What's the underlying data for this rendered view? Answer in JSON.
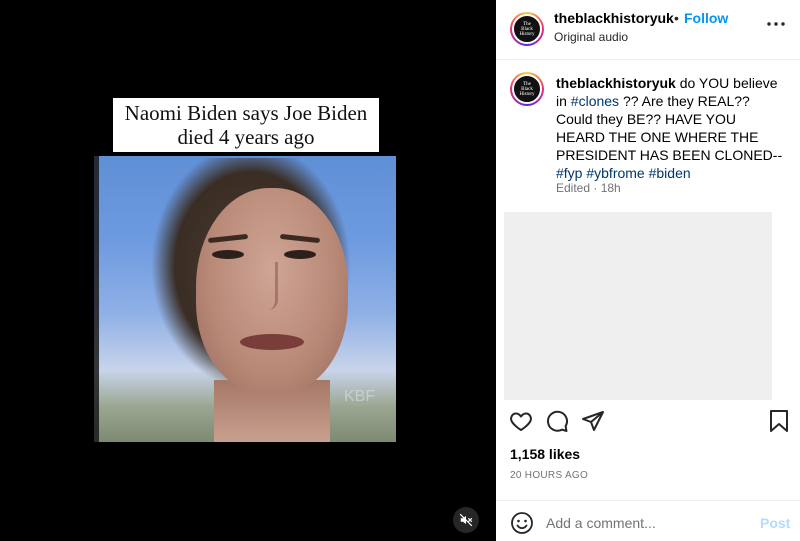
{
  "video": {
    "caption_line1": "Naomi Biden says Joe Biden",
    "caption_line2": "died 4 years ago",
    "watermark": "KBF",
    "mute_icon": "muted-speaker-icon"
  },
  "header": {
    "username": "theblackhistoryuk",
    "separator": "•",
    "follow_label": "Follow",
    "audio_label": "Original audio",
    "avatar_text": "The Black History"
  },
  "caption": {
    "username": "theblackhistoryuk",
    "text_1": " do YOU believe in ",
    "tag_clones": "#clones",
    "text_2": " ?? Are they REAL?? Could they BE?? HAVE YOU HEARD THE ONE WHERE THE PRESIDENT HAS BEEN CLONED-- ",
    "tag_fyp": "#fyp",
    "tag_ybfrome": "#ybfrome",
    "tag_biden": "#biden",
    "meta": "Edited · 18h"
  },
  "actions": {
    "like_icon": "heart-icon",
    "comment_icon": "comment-icon",
    "share_icon": "share-icon",
    "save_icon": "bookmark-icon"
  },
  "stats": {
    "likes": "1,158 likes",
    "time": "20 HOURS AGO"
  },
  "comment": {
    "placeholder": "Add a comment...",
    "post_label": "Post",
    "emoji_icon": "emoji-icon"
  },
  "colors": {
    "accent": "#0095f6",
    "hashtag": "#00376b",
    "post_disabled": "#b3dbff"
  }
}
